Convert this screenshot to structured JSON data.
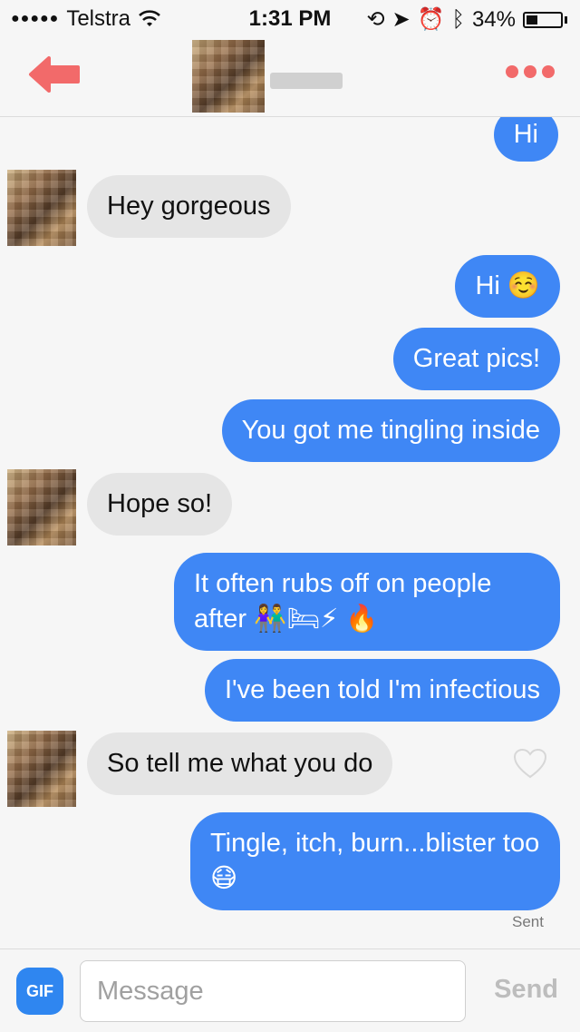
{
  "status_bar": {
    "carrier": "Telstra",
    "time": "1:31 PM",
    "battery": "34%",
    "battery_level": 0.34
  },
  "header": {
    "contact_name": ""
  },
  "messages": [
    {
      "direction": "sent",
      "text": "Hi"
    },
    {
      "direction": "received",
      "text": "Hey gorgeous"
    },
    {
      "direction": "sent",
      "text": "Hi ☺️"
    },
    {
      "direction": "sent",
      "text": "Great pics!"
    },
    {
      "direction": "sent",
      "text": "You got me tingling inside"
    },
    {
      "direction": "received",
      "text": "Hope so!"
    },
    {
      "direction": "sent",
      "text": "It often rubs off on people after 👫🛏⚡ 🔥"
    },
    {
      "direction": "sent",
      "text": "I've been told I'm infectious"
    },
    {
      "direction": "received",
      "text": "So tell me what you do"
    },
    {
      "direction": "sent",
      "text": "Tingle, itch, burn...blister too 😷"
    }
  ],
  "sent_label": "Sent",
  "composer": {
    "gif_label": "GIF",
    "placeholder": "Message",
    "send_label": "Send"
  },
  "colors": {
    "accent": "#3f87f5",
    "back_arrow": "#f26a6a"
  },
  "icons": [
    "back-arrow-icon",
    "more-dots-icon",
    "heart-icon",
    "wifi-icon",
    "location-icon",
    "alarm-icon",
    "bluetooth-icon",
    "battery-icon"
  ]
}
